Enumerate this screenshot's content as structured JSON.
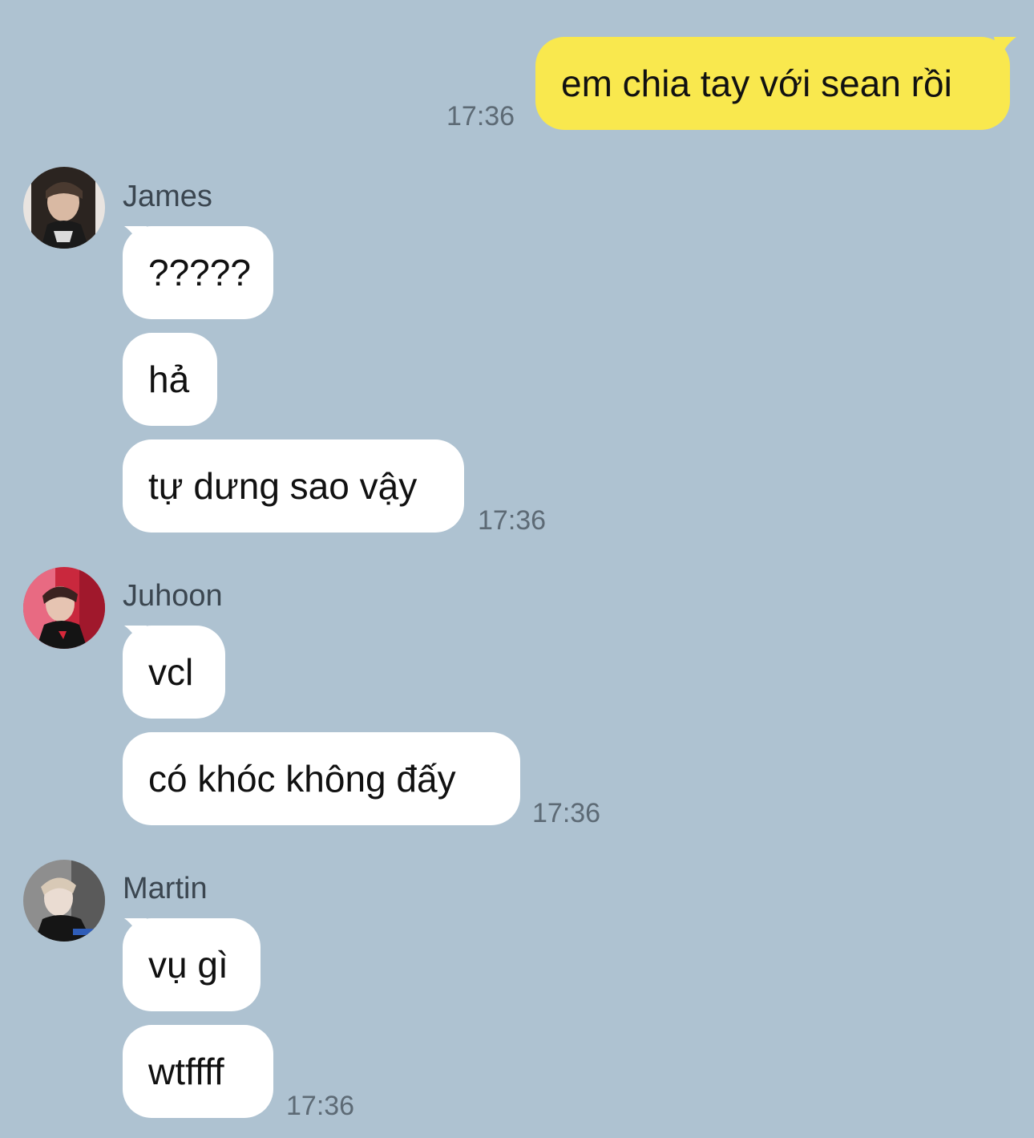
{
  "messages": {
    "outgoing": {
      "text": "em chia tay với sean rồi",
      "time": "17:36"
    },
    "james": {
      "name": "James",
      "bubbles": [
        "?????",
        "hả",
        "tự dưng sao vậy"
      ],
      "time": "17:36"
    },
    "juhoon": {
      "name": "Juhoon",
      "bubbles": [
        "vcl",
        "có khóc không đấy"
      ],
      "time": "17:36"
    },
    "martin": {
      "name": "Martin",
      "bubbles": [
        "vụ gì",
        "wtffff"
      ],
      "time": "17:36"
    }
  },
  "colors": {
    "background": "#aec2d1",
    "outgoing_bubble": "#f9e84e",
    "incoming_bubble": "#ffffff",
    "timestamp": "#5d6a75"
  }
}
